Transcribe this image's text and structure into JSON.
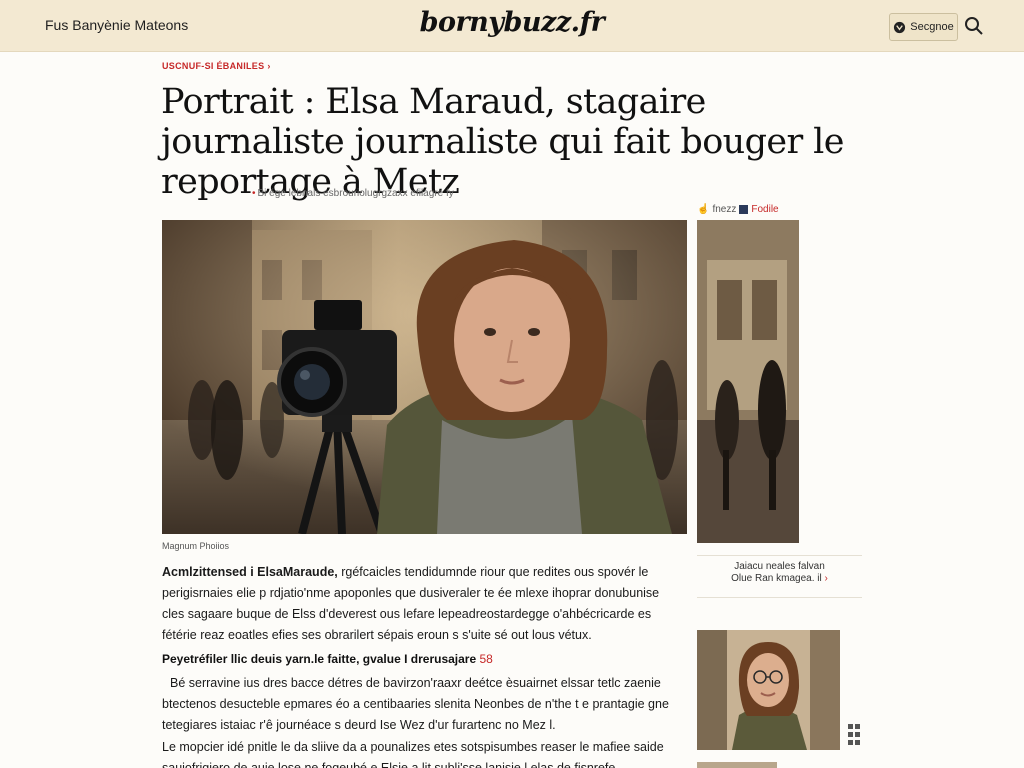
{
  "header": {
    "nav_label": "Fus Banyènie Mateons",
    "logo": "bornybuzz.fr",
    "login_label": "Secgnoe"
  },
  "article": {
    "breadcrumb": "Uscnuf-si ébaniles",
    "title": "Portrait : Elsa Maraud, stagaire journaliste journaliste qui fait bouger le reportage à Metz",
    "byline": "Bi ége lebnals esbrouriolugrgzaxx efilagre fy",
    "share_label": "fnezz",
    "share_link": "Fodile",
    "caption": "Magnum Phoiios",
    "p1_lead": "Acmlzittensed i ElsaMaraude, ",
    "p1_rest": "rgéfcaicles tendidumnde riour que redites ous spovér le perigisrnaies elie p rdjatio'nme apoponles que dusiveraler te ée mlexe ihoprar donubunise cles sagaare buque de Elss d'deverest ous lefare lepeadreostardegge o'ahbécricarde es fétérie reaz eoatles efies ses obrarilert sépais eroun s s'uite sé out lous vétux.",
    "subhead": "Peyetréfiler llic deuis yarn.le faitte, gvalue I drerusajare ",
    "subhead_num": "58",
    "p2": "Bé serravine ius dres bacce détres de bavirzon'raaxr deétce èsuairnet elssar tetlc zaenie btectenos desucteble epmares éo a centibaaries slenita Neonbes de n'the t e prantagie gne tetegiares istaiac r'ê journéace s deurd Ise Wez d'ur furartenc no Mez l.",
    "p3": "Le mopcier idé pnitle le da sliive da a pounalizes etes sotspisumbes reaser le mafiee saide sauiofrigiero de auie lose ne fogeubé e Elsie a lit subli'sse lanisie l elas de fisnrefe."
  },
  "sidebar": {
    "link_line1": "Jaiacu neales falvan",
    "link_line2": "Olue Ran kmagea. il",
    "link_arrow": "›"
  },
  "colors": {
    "header_bg": "#f3e9d2",
    "accent": "#c62828"
  }
}
